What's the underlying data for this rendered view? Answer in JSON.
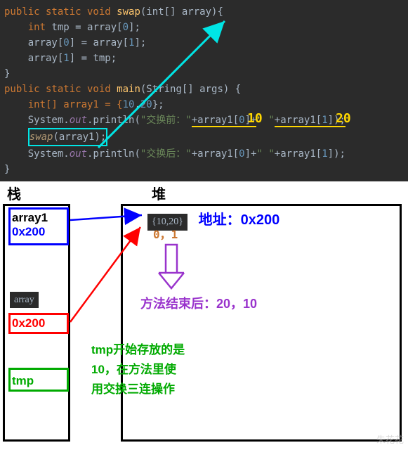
{
  "code": {
    "swap_sig_1": "public static void ",
    "swap_name": "swap",
    "swap_sig_2": "(int[] array){",
    "l2a": "    int ",
    "l2b": "tmp = array[",
    "l2c": "0",
    "l2d": "];",
    "l3a": "    array[",
    "l3b": "0",
    "l3c": "] = array[",
    "l3d": "1",
    "l3e": "];",
    "l4a": "    array[",
    "l4b": "1",
    "l4c": "] = tmp;",
    "l5": "}",
    "main_sig_1": "public static void ",
    "main_name": "main",
    "main_sig_2": "(String[] args) {",
    "l7a": "    int[] array1 = {",
    "l7b": "10",
    "l7c": ",",
    "l7d": "20",
    "l7e": "};",
    "l8a": "    System.",
    "l8b": "out",
    "l8c": ".println(",
    "l8d": "\"交换前：\"",
    "l8e": "+array1[",
    "l8f": "0",
    "l8g": "]+",
    "l8h": "\" \"",
    "l8i": "+array1[",
    "l8j": "1",
    "l8k": "]);",
    "l9a": "    ",
    "l9b": "swap",
    "l9c": "(array1);",
    "l10a": "    System.",
    "l10b": "out",
    "l10c": ".println(",
    "l10d": "\"交换后：\"",
    "l10e": "+array1[",
    "l10f": "0",
    "l10g": "]+",
    "l10h": "\" \"",
    "l10i": "+array1[",
    "l10j": "1",
    "l10k": "]);",
    "l11": "}"
  },
  "annotations": {
    "val10": "10",
    "val20": "20"
  },
  "diagram": {
    "stack_label": "栈",
    "heap_label": "堆",
    "array1_name": "array1",
    "array1_addr": "0x200",
    "array_name": "array",
    "array_addr": "0x200",
    "tmp_name": "tmp",
    "heap_values": "{10,20}",
    "heap_addr_label": "地址：0x200",
    "heap_indices": "0，1",
    "heap_result": "方法结束后：20，10",
    "tmp_note_l1": "tmp开始存放的是",
    "tmp_note_l2": "10，在方法里使",
    "tmp_note_l3": "用交换三连操作"
  },
  "watermark": "朱花花"
}
